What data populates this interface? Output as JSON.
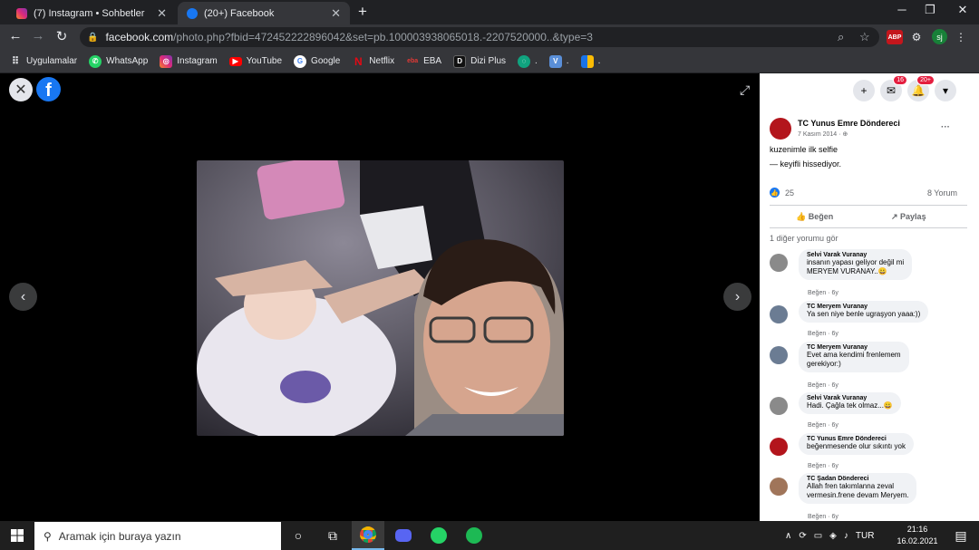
{
  "tabs": [
    {
      "title": "(7) Instagram • Sohbetler",
      "favicon": "instagram-icon"
    },
    {
      "title": "(20+) Facebook",
      "favicon": "facebook-icon"
    }
  ],
  "toolbar": {
    "url_host": "facebook.com",
    "url_path": "/photo.php?fbid=472452222896042&set=pb.100003938065018.-2207520000..&type=3",
    "ext_abp": "ABP",
    "profile": "sj"
  },
  "bookmarks": [
    {
      "label": "Uygulamalar",
      "icon": "apps-grid-icon"
    },
    {
      "label": "WhatsApp",
      "icon": "whatsapp-icon"
    },
    {
      "label": "Instagram",
      "icon": "instagram-icon"
    },
    {
      "label": "YouTube",
      "icon": "youtube-icon"
    },
    {
      "label": "Google",
      "icon": "google-icon"
    },
    {
      "label": "Netflix",
      "icon": "netflix-icon"
    },
    {
      "label": "EBA",
      "icon": "eba-icon"
    },
    {
      "label": "Dizi Plus",
      "icon": "diziplus-icon"
    },
    {
      "label": ".",
      "icon": "chatgpt-icon"
    },
    {
      "label": ".",
      "icon": "v-icon"
    },
    {
      "label": ".",
      "icon": "folder-icon"
    }
  ],
  "panel": {
    "messenger_badge": "16",
    "notification_badge": "20+",
    "author": "TC Yunus Emre Döndereci",
    "date": "7 Kasım 2014 · ",
    "caption": "kuzenimle ilk selfie",
    "feeling": "— keyifli hissediyor.",
    "likes": "25",
    "comment_count": "8 Yorum",
    "like_button": "Beğen",
    "share_button": "Paylaş",
    "more_comments": "1 diğer yorumu gör",
    "comments": [
      {
        "name": "Selvi Varak Vuranay",
        "text1": "insanın yapası geliyor değil mi",
        "text2": "MERYEM VURANAY..😀",
        "action": "Beğen · 6y"
      },
      {
        "name": "TC Meryem Vuranay",
        "text1": "Ya sen niye benle ugraşyon yaaa:))",
        "text2": "",
        "action": "Beğen · 6y"
      },
      {
        "name": "TC Meryem Vuranay",
        "text1": "Evet ama kendimi frenlemem",
        "text2": "gerekiyor:)",
        "action": "Beğen · 6y"
      },
      {
        "name": "Selvi Varak Vuranay",
        "text1": "Hadi. Çağla tek olmaz...😀",
        "text2": "",
        "action": "Beğen · 6y"
      },
      {
        "name": "TC Yunus Emre Döndereci",
        "text1": "beğenmesende olur sıkıntı yok",
        "text2": "",
        "action": "Beğen · 6y"
      },
      {
        "name": "TC Şadan Döndereci",
        "text1": "Allah fren takımlanna zeval",
        "text2": "vermesin.frene devam Meryem.",
        "action": "Beğen · 6y"
      }
    ]
  },
  "taskbar": {
    "search_placeholder": "Aramak için buraya yazın",
    "lang": "TUR",
    "time": "21:16",
    "date": "16.02.2021"
  }
}
